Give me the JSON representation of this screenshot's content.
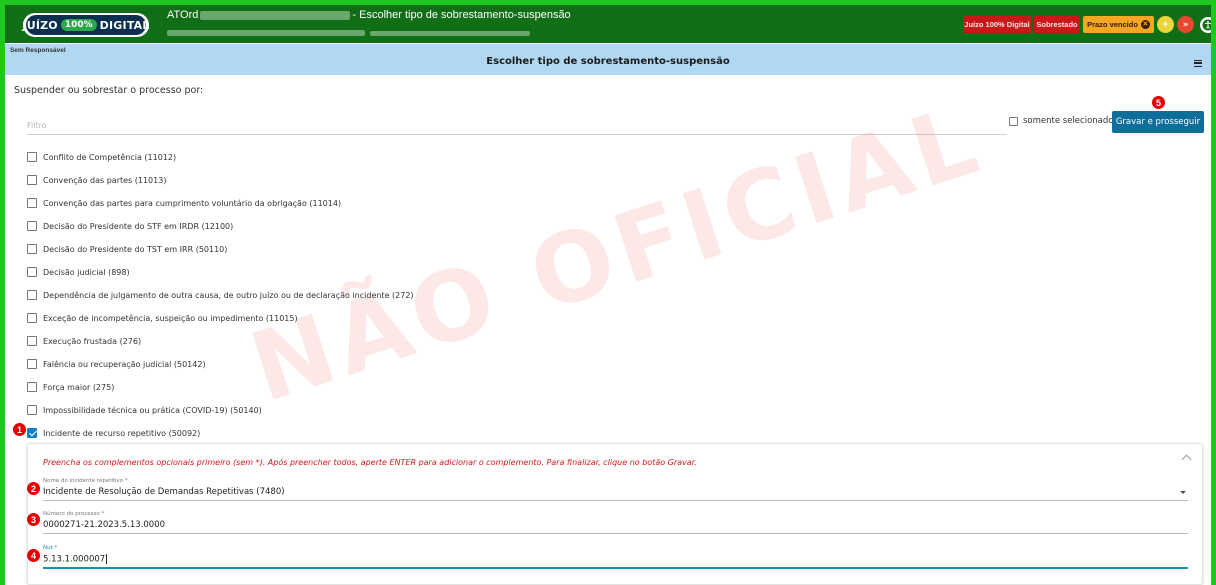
{
  "header": {
    "logo": {
      "left": "JUÍZO",
      "pct": "100%",
      "right": "DIGITAL"
    },
    "title_prefix": "ATOrd",
    "title_suffix": "- Escolher tipo de sobrestamento-suspensão",
    "badges": {
      "juizo": "Juízo 100% Digital",
      "sobrestado": "Sobrestado",
      "prazo": "Prazo vencido"
    },
    "icons": {
      "yellow": "+",
      "red": "»",
      "accessibility": "accessibility-icon"
    }
  },
  "subheader": {
    "responsible": "Sem Responsável",
    "title": "Escolher tipo de sobrestamento-suspensão"
  },
  "main": {
    "prompt": "Suspender ou sobrestar o processo por:",
    "filter_placeholder": "Filtro",
    "only_selected_label": "somente selecionados",
    "save_label": "Gravar e prosseguir"
  },
  "options": [
    {
      "label": "Conflito de Competência (11012)",
      "checked": false
    },
    {
      "label": "Convenção das partes (11013)",
      "checked": false
    },
    {
      "label": "Convenção das partes para cumprimento voluntário da obrigação (11014)",
      "checked": false
    },
    {
      "label": "Decisão do Presidente do STF em IRDR (12100)",
      "checked": false
    },
    {
      "label": "Decisão do Presidente do TST em IRR (50110)",
      "checked": false
    },
    {
      "label": "Decisão judicial (898)",
      "checked": false
    },
    {
      "label": "Dependência de julgamento de outra causa, de outro juízo ou de declaração incidente (272)",
      "checked": false
    },
    {
      "label": "Exceção de incompetência, suspeição ou impedimento (11015)",
      "checked": false
    },
    {
      "label": "Execução frustada (276)",
      "checked": false
    },
    {
      "label": "Falência ou recuperação judicial (50142)",
      "checked": false
    },
    {
      "label": "Força maior (275)",
      "checked": false
    },
    {
      "label": "Impossibilidade técnica ou prática (COVID-19) (50140)",
      "checked": false
    },
    {
      "label": "Incidente de recurso repetitivo (50092)",
      "checked": true
    }
  ],
  "complement": {
    "instruction": "Preencha os complementos opcionais primeiro (sem *). Após preencher todos, aperte ENTER para adicionar o complemento. Para finalizar, clique no botão Gravar.",
    "incidente": {
      "label": "Nome do incidente repetitivo *",
      "value": "Incidente de Resolução de Demandas Repetitivas (7480)"
    },
    "processo": {
      "label": "Número do processo *",
      "value": "0000271-21.2023.5.13.0000"
    },
    "nut": {
      "label": "Nut *",
      "value": "5.13.1.000007"
    }
  },
  "markers": [
    "1",
    "2",
    "3",
    "4",
    "5"
  ],
  "watermark": "NÃO OFICIAL",
  "colors": {
    "topbar": "#106e16",
    "subbar": "#b0d8f2",
    "primary_button": "#0f6d9c",
    "badge_red": "#c81818",
    "badge_orange": "#f5a623",
    "instruction": "#d21a1a",
    "focus": "#1a8fb2"
  }
}
